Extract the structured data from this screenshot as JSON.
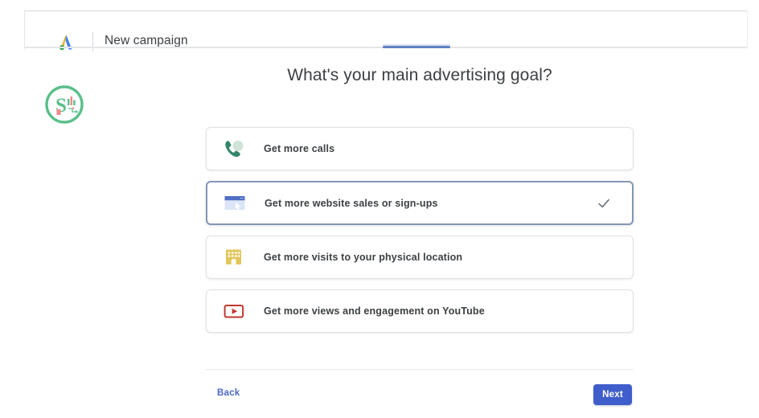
{
  "header": {
    "logo_icon": "google-ads-logo-icon",
    "title": "New campaign"
  },
  "progress": {
    "percent": 16,
    "fill_color": "#4a6bbd",
    "track_color": "#e4e6e9"
  },
  "watermark": {
    "icon": "s-analytics-circle-logo-icon",
    "color": "#5bbf8a"
  },
  "main": {
    "title": "What's your main advertising goal?",
    "options": [
      {
        "label": "Get more calls",
        "icon": "phone-call-icon",
        "icon_color": "#34866b",
        "selected": false
      },
      {
        "label": "Get more website sales or sign-ups",
        "icon": "browser-window-cursor-icon",
        "icon_color": "#5b7fd4",
        "selected": true
      },
      {
        "label": "Get more visits to your physical location",
        "icon": "store-building-icon",
        "icon_color": "#e3c65a",
        "selected": false
      },
      {
        "label": "Get more views and engagement on YouTube",
        "icon": "youtube-play-icon",
        "icon_color": "#c0392f",
        "selected": false
      }
    ],
    "check_icon": "checkmark-icon"
  },
  "footer": {
    "back_label": "Back",
    "next_label": "Next",
    "next_color": "#3f5ecc",
    "back_color": "#4b68c4"
  }
}
